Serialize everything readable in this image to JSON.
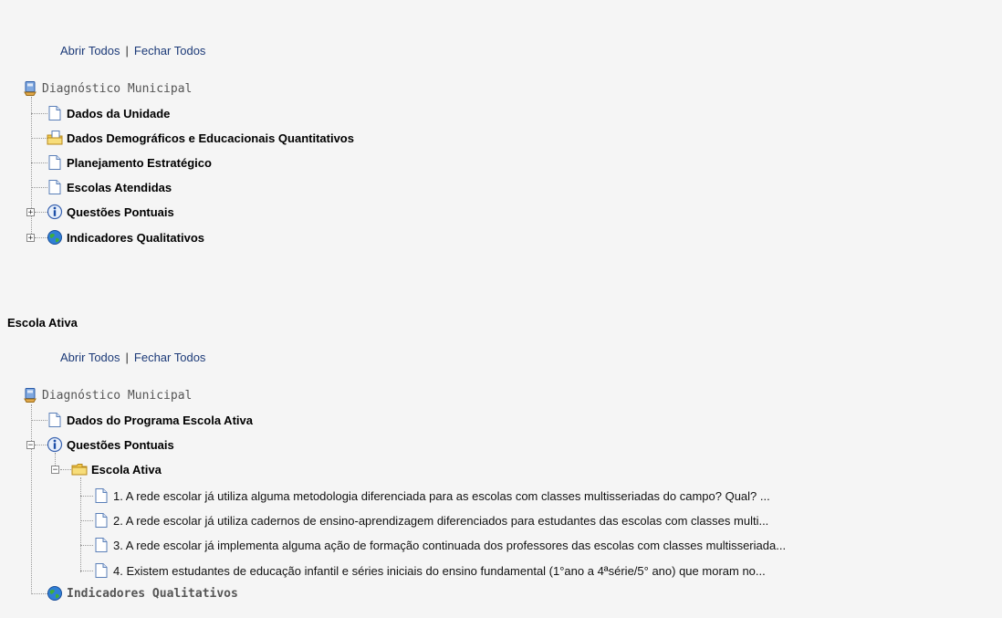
{
  "tree1": {
    "abrir": "Abrir Todos",
    "fechar": "Fechar Todos",
    "sep": "|",
    "root": "Diagnóstico Municipal",
    "items": [
      "Dados da Unidade",
      "Dados Demográficos e Educacionais Quantitativos",
      "Planejamento Estratégico",
      "Escolas Atendidas",
      "Questões Pontuais",
      "Indicadores Qualitativos"
    ]
  },
  "section": {
    "title": "Escola Ativa"
  },
  "tree2": {
    "abrir": "Abrir Todos",
    "fechar": "Fechar Todos",
    "sep": "|",
    "root": "Diagnóstico Municipal",
    "item_dados": "Dados do Programa Escola Ativa",
    "item_questoes": "Questões Pontuais",
    "folder": "Escola Ativa",
    "questions": [
      "1. A rede escolar já utiliza alguma metodologia diferenciada para as escolas com classes multisseriadas do campo? Qual? ...",
      "2. A rede escolar já utiliza cadernos de ensino-aprendizagem diferenciados para estudantes das escolas com classes multi...",
      "3. A rede escolar já implementa alguma ação de formação continuada dos professores das escolas com classes multisseriada...",
      "4. Existem estudantes de educação infantil e séries iniciais do ensino fundamental (1°ano a 4ªsérie/5° ano) que moram no..."
    ],
    "item_indicadores": "Indicadores Qualitativos"
  },
  "colors": {
    "link": "#1c3a78",
    "background": "#f5f5f5"
  }
}
